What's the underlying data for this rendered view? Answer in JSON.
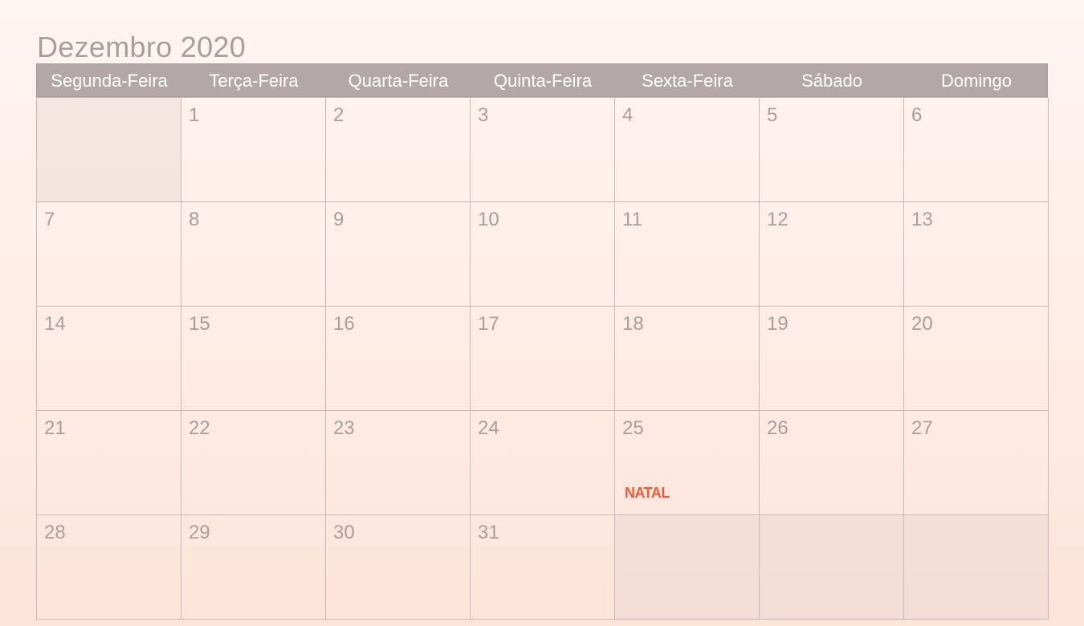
{
  "title": "Dezembro 2020",
  "weekdays": [
    "Segunda-Feira",
    "Terça-Feira",
    "Quarta-Feira",
    "Quinta-Feira",
    "Sexta-Feira",
    "Sábado",
    "Domingo"
  ],
  "weeks": [
    [
      {
        "day": ""
      },
      {
        "day": "1"
      },
      {
        "day": "2"
      },
      {
        "day": "3"
      },
      {
        "day": "4"
      },
      {
        "day": "5"
      },
      {
        "day": "6"
      }
    ],
    [
      {
        "day": "7"
      },
      {
        "day": "8"
      },
      {
        "day": "9"
      },
      {
        "day": "10"
      },
      {
        "day": "11"
      },
      {
        "day": "12"
      },
      {
        "day": "13"
      }
    ],
    [
      {
        "day": "14"
      },
      {
        "day": "15"
      },
      {
        "day": "16"
      },
      {
        "day": "17"
      },
      {
        "day": "18"
      },
      {
        "day": "19"
      },
      {
        "day": "20"
      }
    ],
    [
      {
        "day": "21"
      },
      {
        "day": "22"
      },
      {
        "day": "23"
      },
      {
        "day": "24"
      },
      {
        "day": "25",
        "event": "NATAL"
      },
      {
        "day": "26"
      },
      {
        "day": "27"
      }
    ],
    [
      {
        "day": "28"
      },
      {
        "day": "29"
      },
      {
        "day": "30"
      },
      {
        "day": "31"
      },
      {
        "day": ""
      },
      {
        "day": ""
      },
      {
        "day": ""
      }
    ]
  ]
}
